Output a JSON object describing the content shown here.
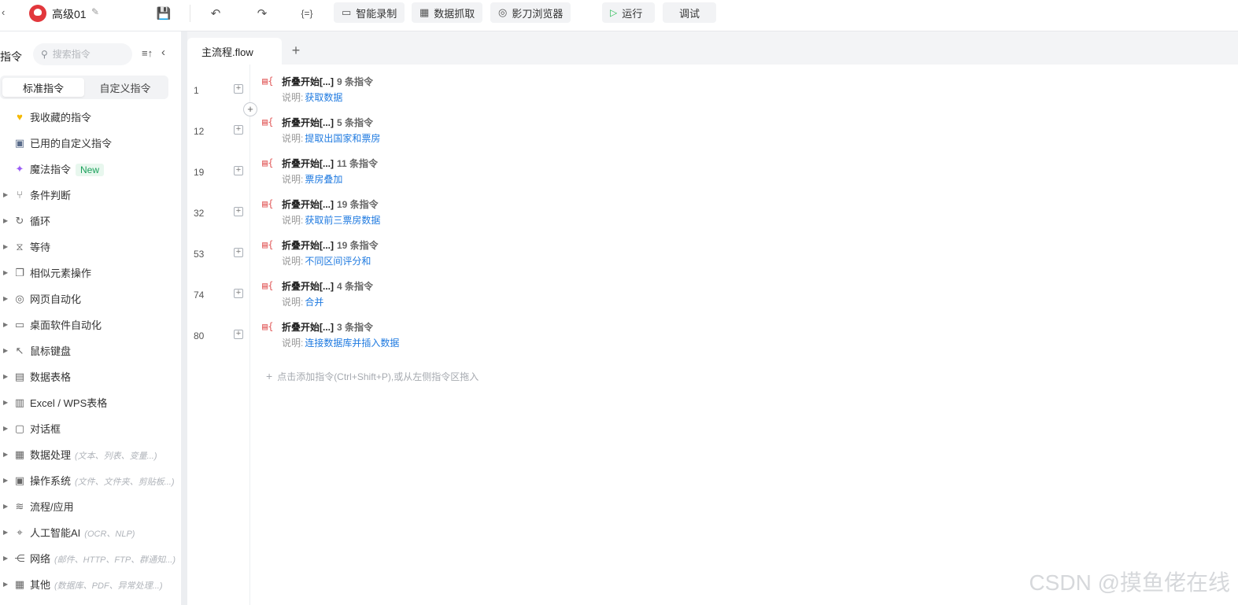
{
  "toolbar": {
    "project_name": "高级01",
    "buttons": {
      "record": "智能录制",
      "scrape": "数据抓取",
      "browser": "影刀浏览器",
      "run": "运行",
      "debug": "调试"
    },
    "variables_icon": "{=}"
  },
  "left_panel": {
    "title": "指令",
    "search_placeholder": "搜索指令",
    "tabs": [
      "标准指令",
      "自定义指令"
    ],
    "items": [
      {
        "label": "我收藏的指令",
        "icon": "heart-icon",
        "hint": ""
      },
      {
        "label": "已用的自定义指令",
        "icon": "calendar-icon",
        "hint": ""
      },
      {
        "label": "魔法指令",
        "icon": "sparkle-icon",
        "hint": "",
        "badge": "New"
      },
      {
        "label": "条件判断",
        "icon": "branch-icon",
        "hint": ""
      },
      {
        "label": "循环",
        "icon": "loop-icon",
        "hint": ""
      },
      {
        "label": "等待",
        "icon": "hourglass-icon",
        "hint": ""
      },
      {
        "label": "相似元素操作",
        "icon": "copy-icon",
        "hint": ""
      },
      {
        "label": "网页自动化",
        "icon": "browser-icon",
        "hint": ""
      },
      {
        "label": "桌面软件自动化",
        "icon": "monitor-icon",
        "hint": ""
      },
      {
        "label": "鼠标键盘",
        "icon": "cursor-icon",
        "hint": ""
      },
      {
        "label": "数据表格",
        "icon": "document-icon",
        "hint": ""
      },
      {
        "label": "Excel / WPS表格",
        "icon": "excel-icon",
        "hint": ""
      },
      {
        "label": "对话框",
        "icon": "dialog-icon",
        "hint": ""
      },
      {
        "label": "数据处理",
        "icon": "data-icon",
        "hint": "(文本、列表、变量...)"
      },
      {
        "label": "操作系统",
        "icon": "briefcase-icon",
        "hint": "(文件、文件夹、剪贴板...)"
      },
      {
        "label": "流程/应用",
        "icon": "layers-icon",
        "hint": ""
      },
      {
        "label": "人工智能AI",
        "icon": "location-icon",
        "hint": "(OCR、NLP)"
      },
      {
        "label": "网络",
        "icon": "share-icon",
        "hint": "(邮件、HTTP、FTP、群通知...)"
      },
      {
        "label": "其他",
        "icon": "grid-icon",
        "hint": "(数据库、PDF、异常处理...)"
      }
    ]
  },
  "main": {
    "tab_label": "主流程.flow",
    "blocks": [
      {
        "line": "1",
        "title": "折叠开始[...]",
        "count": "9 条指令",
        "desc_label": "说明:",
        "desc": "获取数据"
      },
      {
        "line": "12",
        "title": "折叠开始[...]",
        "count": "5 条指令",
        "desc_label": "说明:",
        "desc": "提取出国家和票房"
      },
      {
        "line": "19",
        "title": "折叠开始[...]",
        "count": "11 条指令",
        "desc_label": "说明:",
        "desc": "票房叠加"
      },
      {
        "line": "32",
        "title": "折叠开始[...]",
        "count": "19 条指令",
        "desc_label": "说明:",
        "desc": "获取前三票房数据"
      },
      {
        "line": "53",
        "title": "折叠开始[...]",
        "count": "19 条指令",
        "desc_label": "说明:",
        "desc": "不同区间评分和"
      },
      {
        "line": "74",
        "title": "折叠开始[...]",
        "count": "4 条指令",
        "desc_label": "说明:",
        "desc": "合并"
      },
      {
        "line": "80",
        "title": "折叠开始[...]",
        "count": "3 条指令",
        "desc_label": "说明:",
        "desc": "连接数据库并插入数据"
      }
    ],
    "add_hint": "点击添加指令(Ctrl+Shift+P),或从左侧指令区拖入"
  },
  "watermark": "CSDN @摸鱼佬在线"
}
